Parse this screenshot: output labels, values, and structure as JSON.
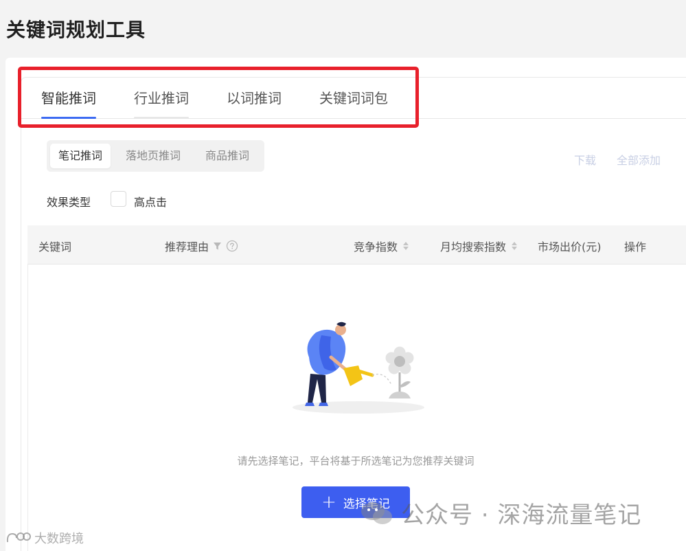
{
  "page_title": "关键词规划工具",
  "main_tabs": [
    {
      "label": "智能推词",
      "active": true
    },
    {
      "label": "行业推词",
      "active": false
    },
    {
      "label": "以词推词",
      "active": false
    },
    {
      "label": "关键词词包",
      "active": false
    }
  ],
  "sub_tabs": [
    {
      "label": "笔记推词",
      "active": true
    },
    {
      "label": "落地页推词",
      "active": false
    },
    {
      "label": "商品推词",
      "active": false
    }
  ],
  "actions": {
    "download": "下载",
    "add_all": "全部添加"
  },
  "filter": {
    "label": "效果类型",
    "option": "高点击",
    "checked": false
  },
  "table": {
    "columns": [
      "关键词",
      "推荐理由",
      "竞争指数",
      "月均搜索指数",
      "市场出价(元)",
      "操作"
    ]
  },
  "empty_state": {
    "message": "请先选择笔记，平台将基于所选笔记为您推荐关键词",
    "button_label": "选择笔记"
  },
  "watermarks": {
    "right": "公众号 · 深海流量笔记",
    "left": "大数跨境"
  },
  "colors": {
    "accent": "#3d5ef0",
    "active_tab_underline": "#3d6bf2",
    "highlight_box": "#e8202b"
  }
}
